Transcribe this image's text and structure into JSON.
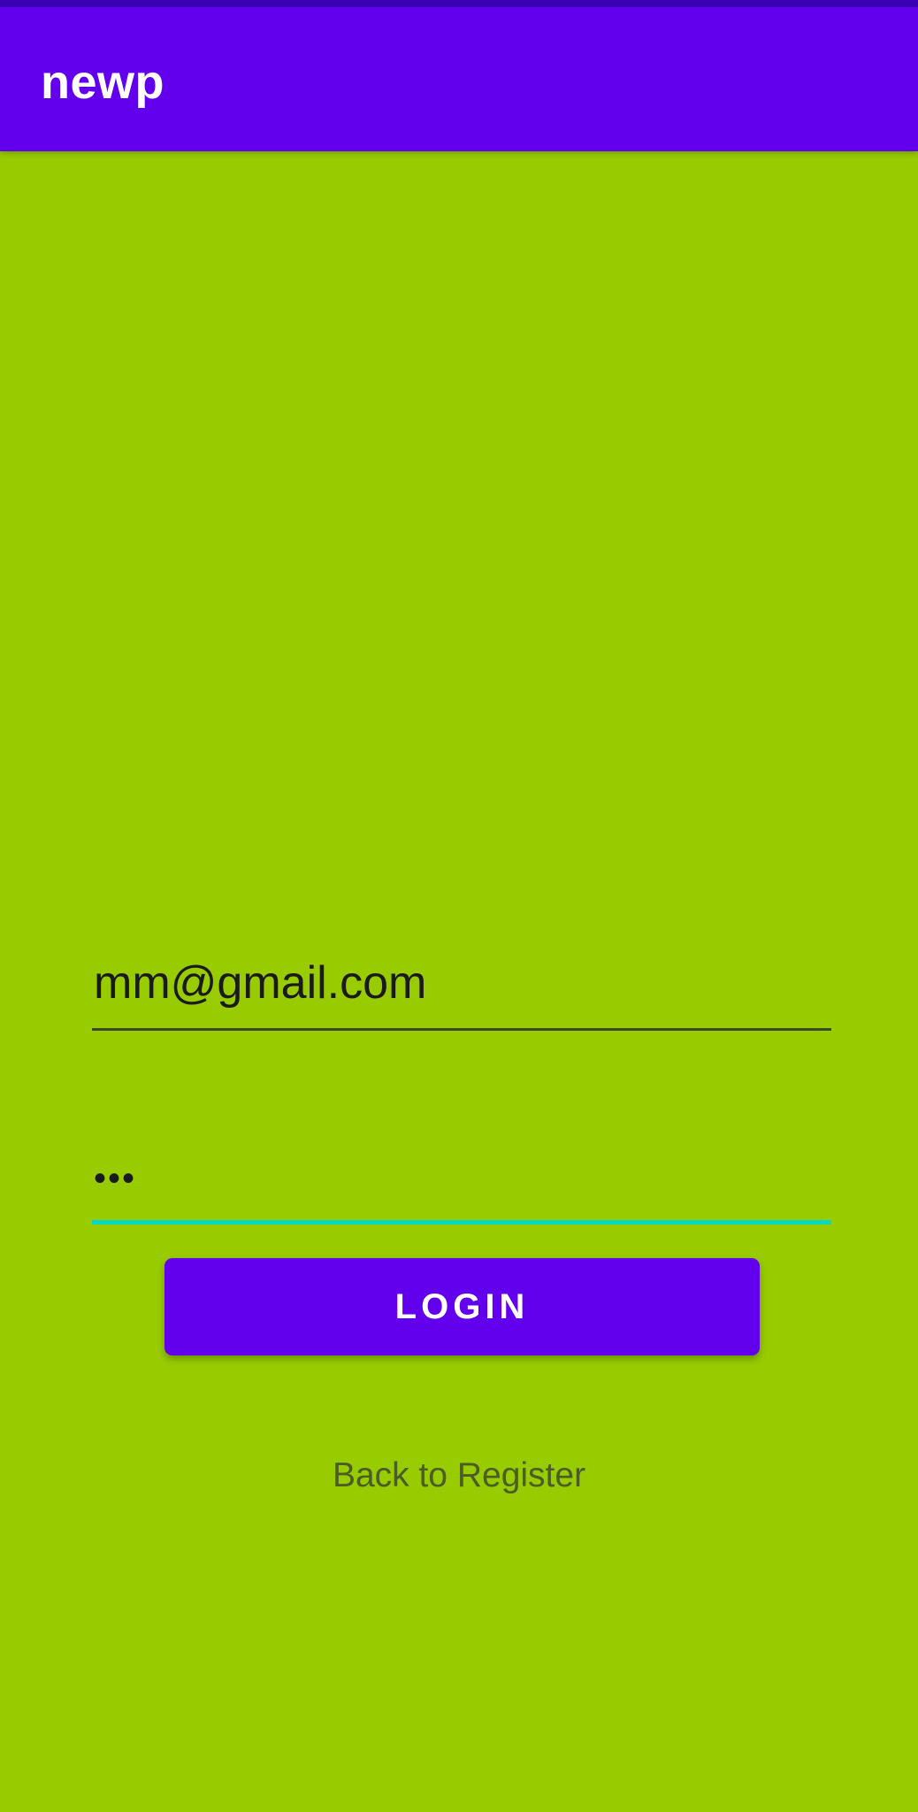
{
  "app_bar": {
    "title": "newp"
  },
  "login_form": {
    "email": {
      "value": "mm@gmail.com"
    },
    "password": {
      "masked_value": "•••"
    },
    "login_button_label": "LOGIN",
    "back_link_label": "Back to Register"
  },
  "colors": {
    "background": "#98cb00",
    "app_bar": "#6200ee",
    "status_bar": "#3a00b6",
    "button": "#6200ee",
    "focused_underline": "#03dac5",
    "link_text": "#4a5d24"
  }
}
